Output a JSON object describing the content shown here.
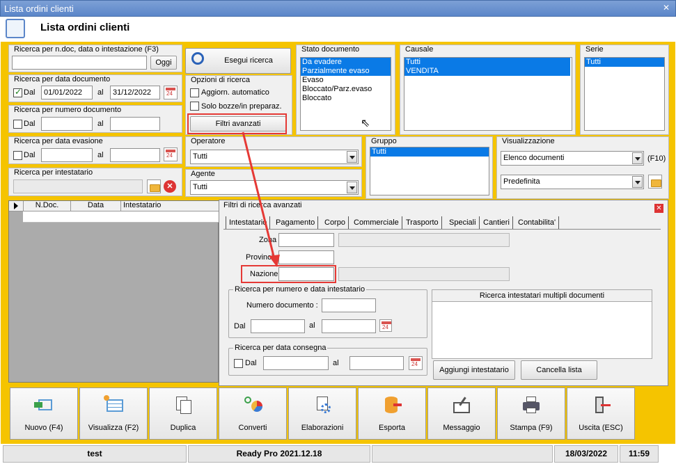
{
  "window": {
    "title": "Lista ordini clienti",
    "close": "✕"
  },
  "header": {
    "title": "Lista ordini clienti"
  },
  "search_ndoc": {
    "label": "Ricerca per n.doc, data o intestazione (F3)",
    "value": "",
    "button": "Oggi"
  },
  "search_date": {
    "label": "Ricerca per data documento",
    "checked": true,
    "dal": "Dal",
    "from": "01/01/2022",
    "al": "al",
    "to": "31/12/2022"
  },
  "search_number": {
    "label": "Ricerca per numero documento",
    "dal": "Dal",
    "al": "al"
  },
  "search_evasione": {
    "label": "Ricerca per data evasione",
    "dal": "Dal",
    "al": "al"
  },
  "search_intest": {
    "label": "Ricerca per intestatario"
  },
  "run_search": "Esegui ricerca",
  "options": {
    "label": "Opzioni di ricerca",
    "auto": "Aggiorn. automatico",
    "bozze": "Solo bozze/in preparaz.",
    "advanced": "Filtri avanzati"
  },
  "stato": {
    "label": "Stato documento",
    "items": [
      "Da evadere",
      "Parzialmente evaso",
      "Evaso",
      "Bloccato/Parz.evaso",
      "Bloccato"
    ]
  },
  "causale": {
    "label": "Causale",
    "items": [
      "Tutti",
      "VENDITA"
    ]
  },
  "serie": {
    "label": "Serie",
    "items": [
      "Tutti"
    ]
  },
  "operatore": {
    "label": "Operatore",
    "value": "Tutti"
  },
  "agente": {
    "label": "Agente",
    "value": "Tutti"
  },
  "gruppo": {
    "label": "Gruppo",
    "items": [
      "Tutti"
    ]
  },
  "visualizzazione": {
    "label": "Visualizzazione",
    "value": "Elenco documenti",
    "hotkey": "(F10)",
    "value2": "Predefinita"
  },
  "grid": {
    "columns": [
      "N.Doc.",
      "Data",
      "Intestatario"
    ]
  },
  "advanced": {
    "title": "Filtri di ricerca avanzati",
    "tabs": [
      "Intestatario",
      "Pagamento",
      "Corpo",
      "Commerciale",
      "Trasporto",
      "Speciali",
      "Cantieri",
      "Contabilita'"
    ],
    "zona": "Zona",
    "provincia": "Provincia",
    "nazione": "Nazione",
    "group1": {
      "label": "Ricerca per numero e data intestatario",
      "numero": "Numero documento :",
      "dal": "Dal",
      "al": "al"
    },
    "multi": {
      "label": "Ricerca intestatari multipli documenti",
      "add": "Aggiungi intestatario",
      "clear": "Cancella lista"
    },
    "group2": {
      "label": "Ricerca per data consegna",
      "dal": "Dal",
      "al": "al"
    }
  },
  "toolbar": [
    "Nuovo (F4)",
    "Visualizza (F2)",
    "Duplica",
    "Converti",
    "Elaborazioni",
    "Esporta",
    "Messaggio",
    "Stampa (F9)",
    "Uscita (ESC)"
  ],
  "statusbar": {
    "user": "test",
    "app": "Ready Pro 2021.12.18",
    "date": "18/03/2022",
    "time": "11:59"
  },
  "colors": {
    "accent": "#f5c400",
    "highlight": "#0a7ae6",
    "annotation": "#e53935"
  }
}
